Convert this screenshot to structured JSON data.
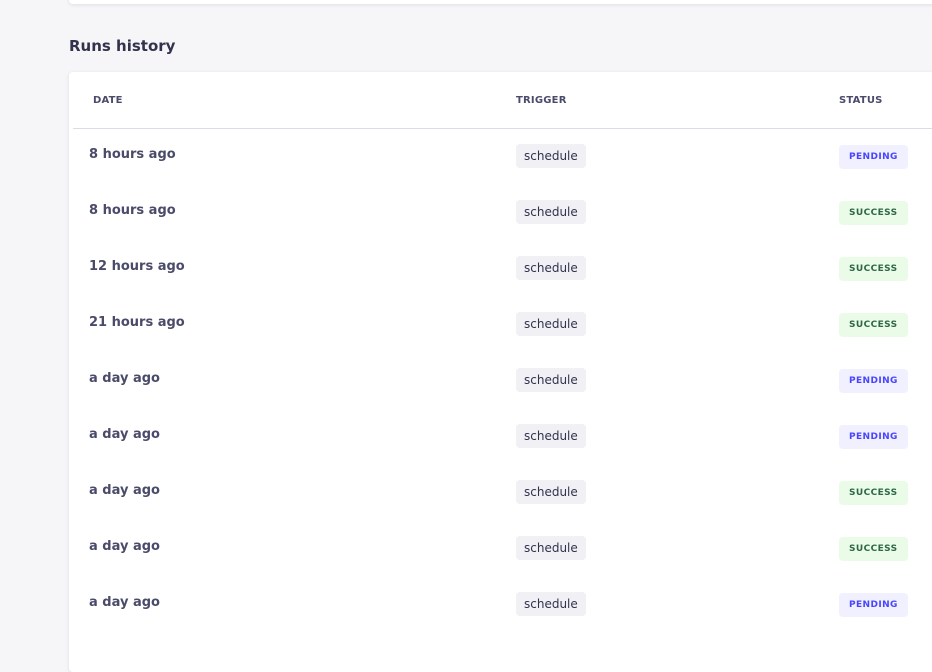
{
  "section": {
    "title": "Runs history"
  },
  "table": {
    "headers": {
      "date": "DATE",
      "trigger": "TRIGGER",
      "status": "STATUS"
    },
    "rows": [
      {
        "date": "8 hours ago",
        "trigger": "schedule",
        "status": "PENDING"
      },
      {
        "date": "8 hours ago",
        "trigger": "schedule",
        "status": "SUCCESS"
      },
      {
        "date": "12 hours ago",
        "trigger": "schedule",
        "status": "SUCCESS"
      },
      {
        "date": "21 hours ago",
        "trigger": "schedule",
        "status": "SUCCESS"
      },
      {
        "date": "a day ago",
        "trigger": "schedule",
        "status": "PENDING"
      },
      {
        "date": "a day ago",
        "trigger": "schedule",
        "status": "PENDING"
      },
      {
        "date": "a day ago",
        "trigger": "schedule",
        "status": "SUCCESS"
      },
      {
        "date": "a day ago",
        "trigger": "schedule",
        "status": "SUCCESS"
      },
      {
        "date": "a day ago",
        "trigger": "schedule",
        "status": "PENDING"
      }
    ]
  },
  "colors": {
    "background": "#f6f6f9",
    "pending_bg": "#f0f0ff",
    "pending_text": "#4945ff",
    "success_bg": "#eafbe7",
    "success_text": "#2f6846"
  }
}
